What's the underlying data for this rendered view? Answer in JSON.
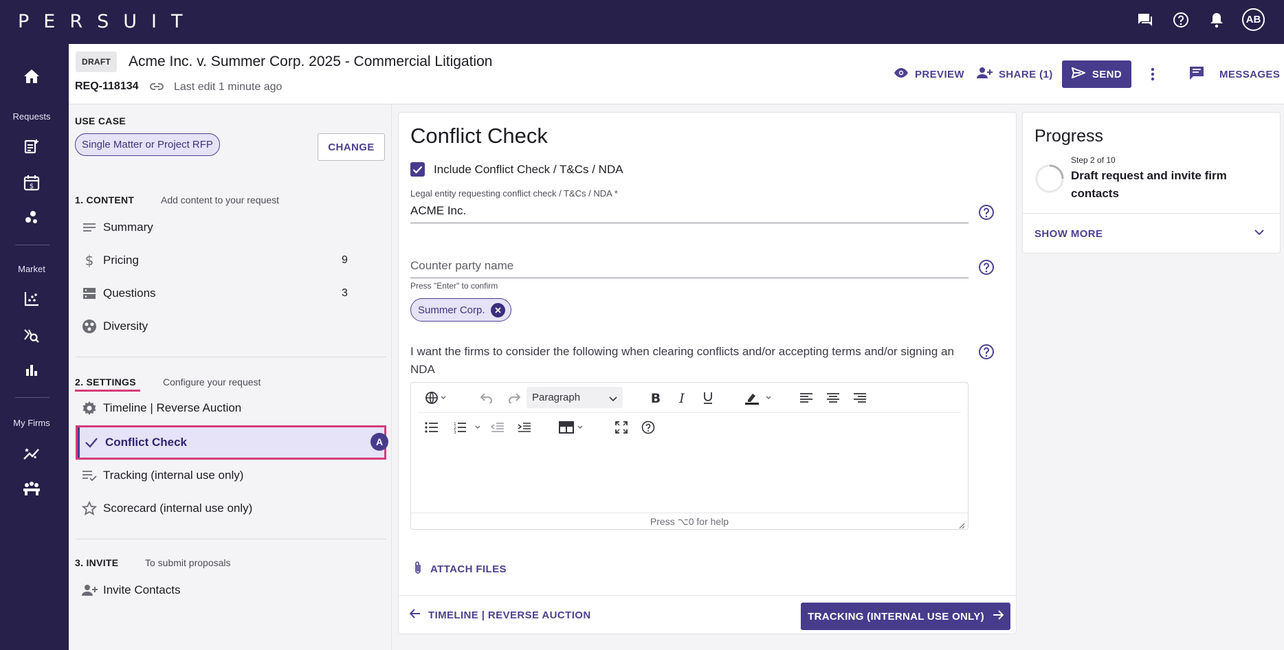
{
  "app": {
    "logo": "PERSUIT",
    "user_initials": "AB"
  },
  "rail": {
    "labels": {
      "requests": "Requests",
      "market": "Market",
      "my_firms": "My Firms"
    }
  },
  "header": {
    "status": "DRAFT",
    "title": "Acme Inc. v. Summer Corp. 2025 - Commercial Litigation",
    "req_id": "REQ-118134",
    "last_edit": "Last edit 1 minute ago",
    "preview": "PREVIEW",
    "share": "SHARE (1)",
    "send": "SEND",
    "messages": "MESSAGES"
  },
  "sidebar": {
    "use_case_label": "USE CASE",
    "use_case_value": "Single Matter or Project RFP",
    "change": "CHANGE",
    "content": {
      "title": "1. CONTENT",
      "desc": "Add content to your request"
    },
    "content_items": [
      {
        "label": "Summary",
        "count": ""
      },
      {
        "label": "Pricing",
        "count": "9"
      },
      {
        "label": "Questions",
        "count": "3"
      },
      {
        "label": "Diversity",
        "count": ""
      }
    ],
    "settings": {
      "title": "2. SETTINGS",
      "desc": "Configure your request"
    },
    "settings_items": [
      {
        "label": "Timeline | Reverse Auction"
      },
      {
        "label": "Conflict Check",
        "badge": "A"
      },
      {
        "label": "Tracking (internal use only)"
      },
      {
        "label": "Scorecard (internal use only)"
      }
    ],
    "invite": {
      "title": "3. INVITE",
      "desc": "To submit proposals"
    },
    "invite_items": [
      {
        "label": "Invite Contacts"
      }
    ]
  },
  "main": {
    "title": "Conflict Check",
    "include_label": "Include Conflict Check / T&Cs / NDA",
    "include_checked": true,
    "entity_label": "Legal entity requesting conflict check / T&Cs / NDA *",
    "entity_value": "ACME Inc.",
    "counterparty_placeholder": "Counter party name",
    "counterparty_hint": "Press \"Enter\" to confirm",
    "counterparty_chip": "Summer Corp.",
    "prompt": "I want the firms to consider the following when clearing conflicts and/or accepting terms and/or signing an NDA",
    "editor": {
      "block_format": "Paragraph",
      "help_hint": "Press ⌥0 for help"
    },
    "attach": "ATTACH FILES",
    "back": "TIMELINE | REVERSE AUCTION",
    "next": "TRACKING (INTERNAL USE ONLY)"
  },
  "progress": {
    "title": "Progress",
    "step": "Step 2 of 10",
    "step_title": "Draft request and invite firm contacts",
    "show_more": "SHOW MORE"
  },
  "colors": {
    "brand": "#26204a",
    "accent": "#473c8c",
    "highlight": "#d63c7a"
  }
}
